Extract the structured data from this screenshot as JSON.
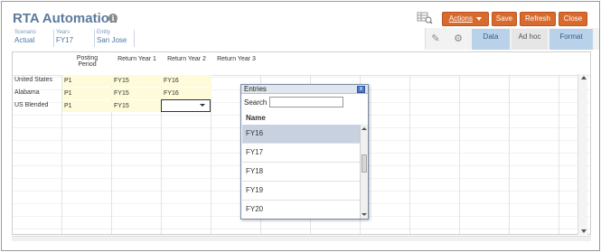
{
  "app": {
    "title": "RTA Automation",
    "info_icon_glyph": "i"
  },
  "toolbar": {
    "actions_label": "Actions",
    "save_label": "Save",
    "refresh_label": "Refresh",
    "close_label": "Close",
    "button_color": "#d86a2e"
  },
  "pov": [
    {
      "label": "Scenario",
      "value": "Actual"
    },
    {
      "label": "Years",
      "value": "FY17"
    },
    {
      "label": "Entity",
      "value": "San Jose"
    }
  ],
  "tabs": {
    "data": "Data",
    "adhoc": "Ad hoc",
    "format": "Format"
  },
  "grid": {
    "column_headers": [
      "Posting\nPeriod",
      "Return Year 1",
      "Return Year 2",
      "Return Year 3"
    ],
    "rows": [
      {
        "label": "United States",
        "cells": [
          "P1",
          "FY15",
          "FY16"
        ]
      },
      {
        "label": "Alabama",
        "cells": [
          "P1",
          "FY15",
          "FY16"
        ]
      },
      {
        "label": "US Blended",
        "cells": [
          "P1",
          "FY15",
          ""
        ]
      }
    ],
    "input_cell_color": "#fdfbd9"
  },
  "popup": {
    "title": "Entries",
    "close_glyph": "x",
    "search_label": "Search",
    "search_value": "",
    "list_header": "Name",
    "items": [
      "FY16",
      "FY17",
      "FY18",
      "FY19",
      "FY20"
    ],
    "selected_item": "FY16"
  }
}
